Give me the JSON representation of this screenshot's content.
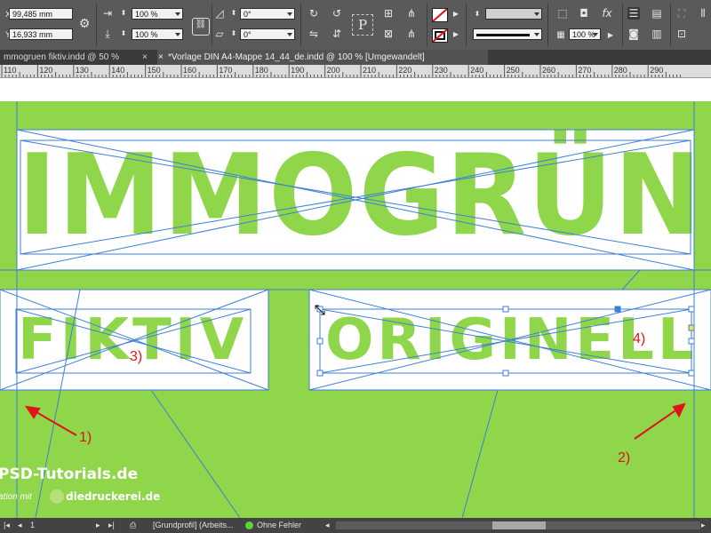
{
  "control_panel": {
    "x_value": "99,485 mm",
    "y_value": "16,933 mm",
    "scale_x": "100 %",
    "scale_y": "100 %",
    "rotation": "0°",
    "shear": "0°",
    "opacity": "100 %"
  },
  "tabs": [
    {
      "label": "mmogruen fiktiv.indd @ 50 %",
      "close": "×"
    },
    {
      "label": "*Vorlage DIN A4-Mappe 14_44_de.indd @ 100 % [Umgewandelt]",
      "close": "×"
    }
  ],
  "ruler": {
    "ticks": [
      "110",
      "120",
      "130",
      "140",
      "150",
      "160",
      "170",
      "180",
      "190",
      "200",
      "210",
      "220",
      "230",
      "240",
      "250",
      "260",
      "270",
      "280",
      "290"
    ]
  },
  "canvas": {
    "colors": {
      "green": "#8fd64b",
      "frame": "#3d7fd6",
      "annotation": "#e0121a"
    },
    "headline": "IMMOGRÜN",
    "word_left": "FIKTIV",
    "word_right": "ORIGINELL",
    "annotations": [
      "1)",
      "2)",
      "3)",
      "4)"
    ],
    "logo_line1": "PSD-Tutorials.de",
    "logo_line2": "ation mit",
    "logo_line3": "diedruckerei.de"
  },
  "status_bar": {
    "page": "1",
    "profile": "[Grundprofil] (Arbeits...",
    "errors": "Ohne Fehler"
  }
}
